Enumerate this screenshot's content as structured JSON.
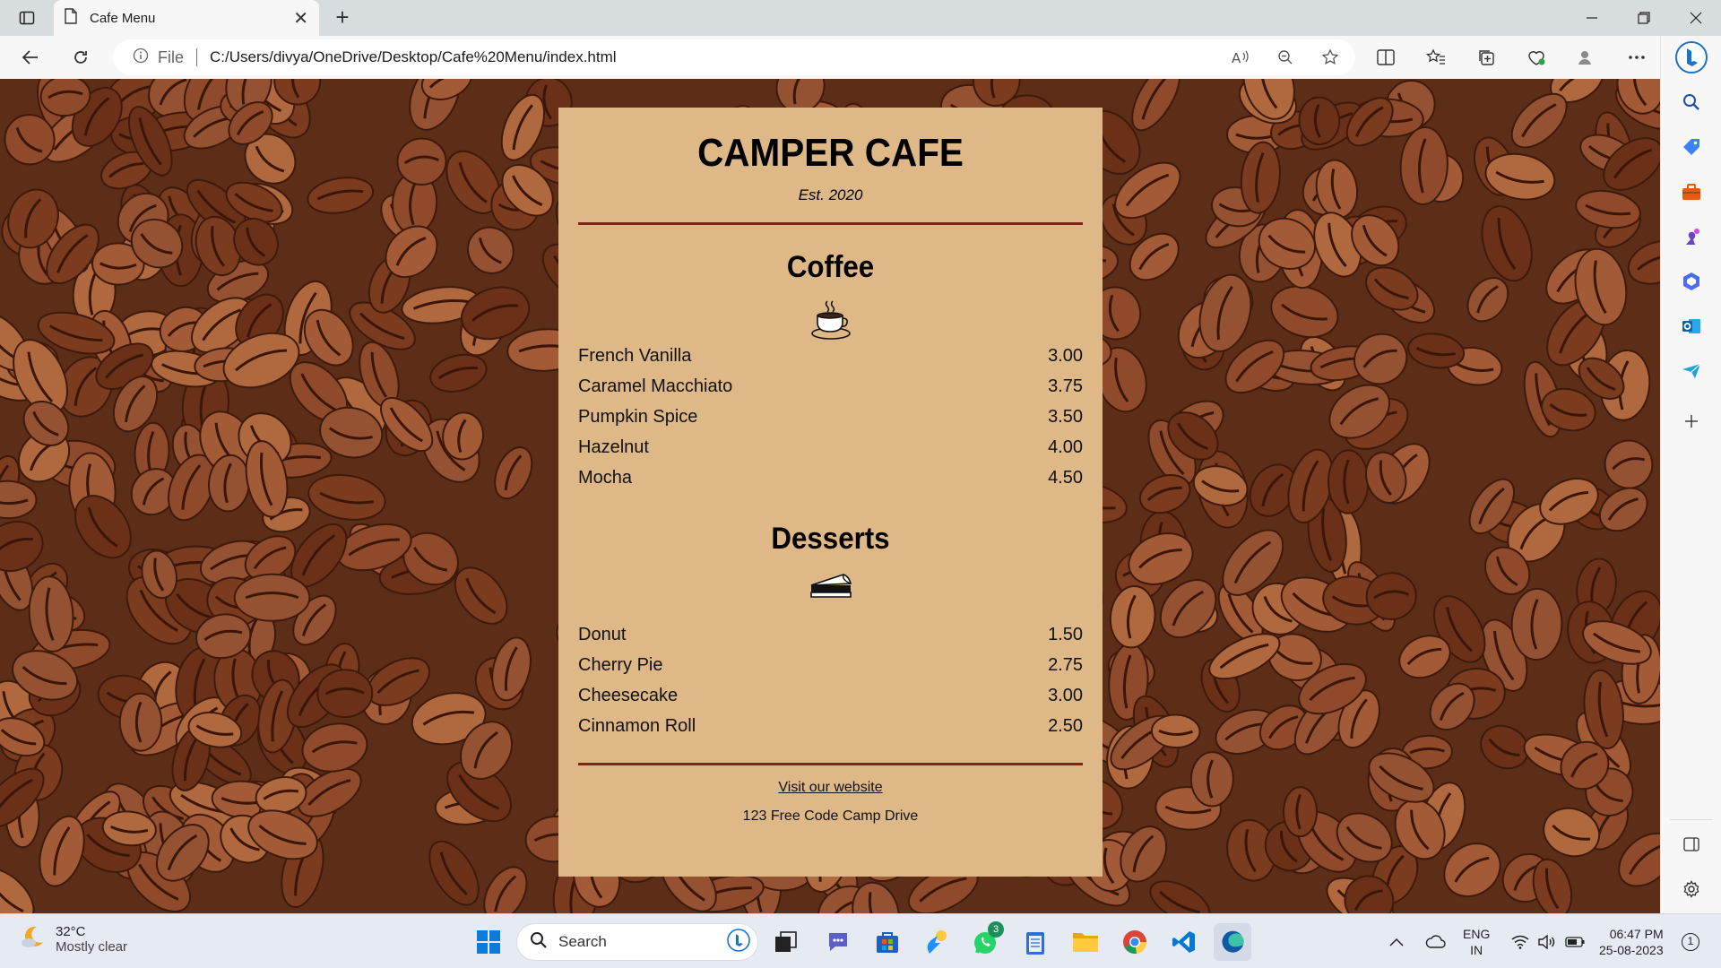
{
  "browser": {
    "tab_title": "Cafe Menu",
    "file_label": "File",
    "url": "C:/Users/divya/OneDrive/Desktop/Cafe%20Menu/index.html"
  },
  "menu": {
    "title": "CAMPER CAFE",
    "established": "Est. 2020",
    "sections": [
      {
        "heading": "Coffee",
        "icon": "coffee-cup-icon",
        "items": [
          {
            "name": "French Vanilla",
            "price": "3.00"
          },
          {
            "name": "Caramel Macchiato",
            "price": "3.75"
          },
          {
            "name": "Pumpkin Spice",
            "price": "3.50"
          },
          {
            "name": "Hazelnut",
            "price": "4.00"
          },
          {
            "name": "Mocha",
            "price": "4.50"
          }
        ]
      },
      {
        "heading": "Desserts",
        "icon": "pie-slice-icon",
        "items": [
          {
            "name": "Donut",
            "price": "1.50"
          },
          {
            "name": "Cherry Pie",
            "price": "2.75"
          },
          {
            "name": "Cheesecake",
            "price": "3.00"
          },
          {
            "name": "Cinnamon Roll",
            "price": "2.50"
          }
        ]
      }
    ],
    "footer": {
      "link": "Visit our website",
      "address": "123 Free Code Camp Drive"
    }
  },
  "taskbar": {
    "weather_temp": "32°C",
    "weather_condition": "Mostly clear",
    "search_placeholder": "Search",
    "whatsapp_badge": "3",
    "language": "ENG",
    "region": "IN",
    "time": "06:47 PM",
    "date": "25-08-2023",
    "notification_count": "1"
  },
  "colors": {
    "menu_background": "#deb887",
    "rule": "#7e2518",
    "edge_accent": "#0c59a4"
  }
}
